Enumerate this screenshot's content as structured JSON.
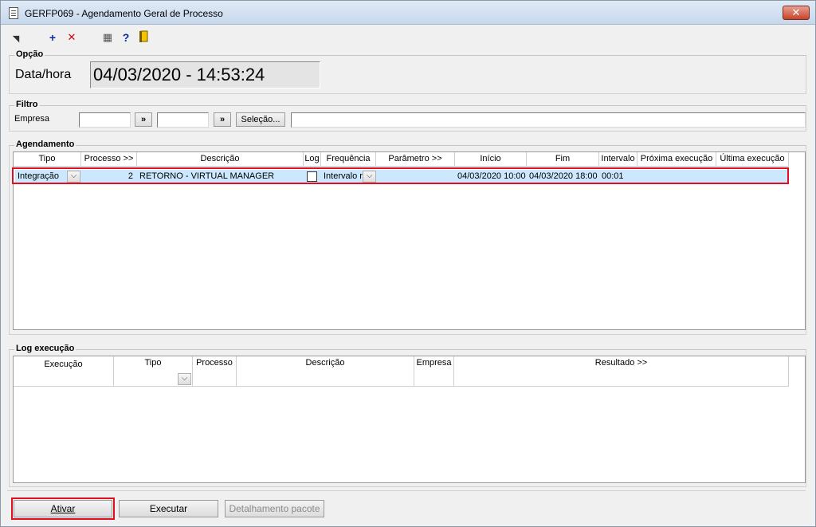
{
  "window": {
    "title": "GERFP069 - Agendamento Geral de Processo",
    "close_glyph": "✕"
  },
  "toolbar": {
    "items": [
      {
        "name": "first-record-icon",
        "glyph": "◥",
        "color": "#333333"
      },
      {
        "name": "add-icon",
        "glyph": "+",
        "color": "#0a2b9b"
      },
      {
        "name": "delete-icon",
        "glyph": "✕",
        "color": "#d4000f"
      },
      {
        "name": "calendar-icon",
        "glyph": "▦",
        "color": "#555555"
      },
      {
        "name": "help-icon",
        "glyph": "?",
        "color": "#0a2b9b"
      },
      {
        "name": "exit-door-icon",
        "glyph": "⮹",
        "color": "#c79400"
      }
    ]
  },
  "opcao": {
    "label": "Opção",
    "field_label": "Data/hora",
    "value": "04/03/2020  -  14:53:24"
  },
  "filtro": {
    "label": "Filtro",
    "empresa_label": "Empresa",
    "empresa_from": "",
    "empresa_to": "",
    "btn_more": "»",
    "btn_selecao": "Seleção...",
    "selection_text": ""
  },
  "agendamento": {
    "label": "Agendamento",
    "columns": [
      "Tipo",
      "Processo >>",
      "Descrição",
      "Log",
      "Frequência",
      "Parâmetro >>",
      "Início",
      "Fim",
      "Intervalo",
      "Próxima execução",
      "Última execução"
    ],
    "rows": [
      {
        "tipo": "Integração",
        "processo": "2",
        "descricao": "RETORNO - VIRTUAL MANAGER",
        "log": false,
        "frequencia": "Intervalo r",
        "parametro": "",
        "inicio": "04/03/2020 10:00",
        "fim": "04/03/2020 18:00",
        "intervalo": "00:01",
        "proxima": "",
        "ultima": ""
      }
    ]
  },
  "log_execucao": {
    "label": "Log execução",
    "columns": [
      "Execução",
      "Tipo",
      "Processo",
      "Descrição",
      "Empresa",
      "Resultado >>"
    ]
  },
  "actions": {
    "ativar": "Ativar",
    "executar": "Executar",
    "detalhamento": "Detalhamento pacote"
  },
  "colors": {
    "selection_row": "#cce8ff",
    "focus_red": "#e01020"
  }
}
